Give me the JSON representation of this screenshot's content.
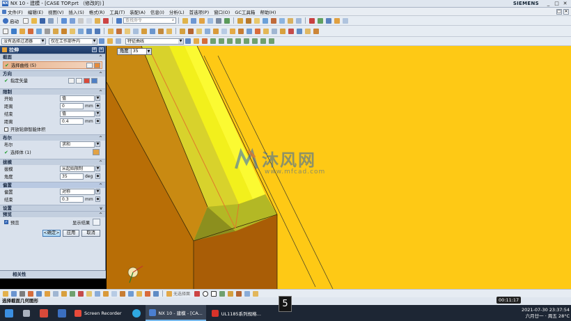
{
  "window": {
    "title": "NX 10 - 建模 - [CASE TOP.prt （修改的）]",
    "brand": "SIEMENS",
    "controls": [
      "_",
      "□",
      "✕"
    ]
  },
  "menubar": {
    "items": [
      "文件(F)",
      "编辑(E)",
      "视图(V)",
      "插入(S)",
      "格式(R)",
      "工具(T)",
      "装配(A)",
      "信息(I)",
      "分析(L)",
      "首选项(P)",
      "窗口(O)",
      "GC工具箱",
      "帮助(H)"
    ]
  },
  "toolbar1": {
    "start_label": "启动",
    "search_placeholder": "查找命令"
  },
  "toolbar3": {
    "filter_value": "没有选择过滤器",
    "scope_value": "仅在工作部件内",
    "curve_rule_value": "特征曲线"
  },
  "dialog": {
    "title": "拉伸",
    "sections": {
      "section": {
        "header": "截面",
        "select_curve": "选择曲线 (5)"
      },
      "direction": {
        "header": "方向",
        "specify_vector": "指定矢量"
      },
      "limits": {
        "header": "限制",
        "start_label": "开始",
        "start_value": "值",
        "start_dist_label": "距离",
        "start_dist_value": "0",
        "end_label": "结束",
        "end_value": "值",
        "end_dist_label": "距离",
        "end_dist_value": "0.4",
        "unit": "mm",
        "open_profile": "开放轮廓智能体积"
      },
      "boolean": {
        "header": "布尔",
        "boolean_label": "布尔",
        "boolean_value": "求和",
        "select_body": "选择体 (1)"
      },
      "draft": {
        "header": "拔模",
        "draft_label": "拔模",
        "draft_value": "从起始限制",
        "angle_label": "角度",
        "angle_value": "35",
        "angle_unit": "deg"
      },
      "offset": {
        "header": "偏置",
        "offset_label": "偏置",
        "offset_value": "对称",
        "end_label": "结束",
        "end_value": "0.3",
        "unit": "mm"
      },
      "settings": {
        "header": "设置"
      },
      "preview": {
        "header": "预览",
        "preview_label": "预览",
        "show_result": "显示结果"
      }
    },
    "buttons": {
      "ok": "<确定>",
      "apply": "应用",
      "cancel": "取消"
    },
    "footer": "相关性"
  },
  "viewport": {
    "angle_label": "角度",
    "angle_value": "35",
    "bg_color": "#fec915",
    "watermark_cn": "沐风网",
    "watermark_url": "www.mfcad.com"
  },
  "bottombar": {
    "layer_label": "无选择面"
  },
  "status": {
    "text": "选择截面几何图形"
  },
  "taskbar": {
    "apps": [
      "Screen Recorder",
      "NX 10 - 建模 - [CA...",
      "UL1185系列规格..."
    ],
    "recording_badge": "5",
    "timer": "00:11:17",
    "datetime": "2021-07-30 23:37:54",
    "day": "六月廿一 · 周五 28°C"
  }
}
